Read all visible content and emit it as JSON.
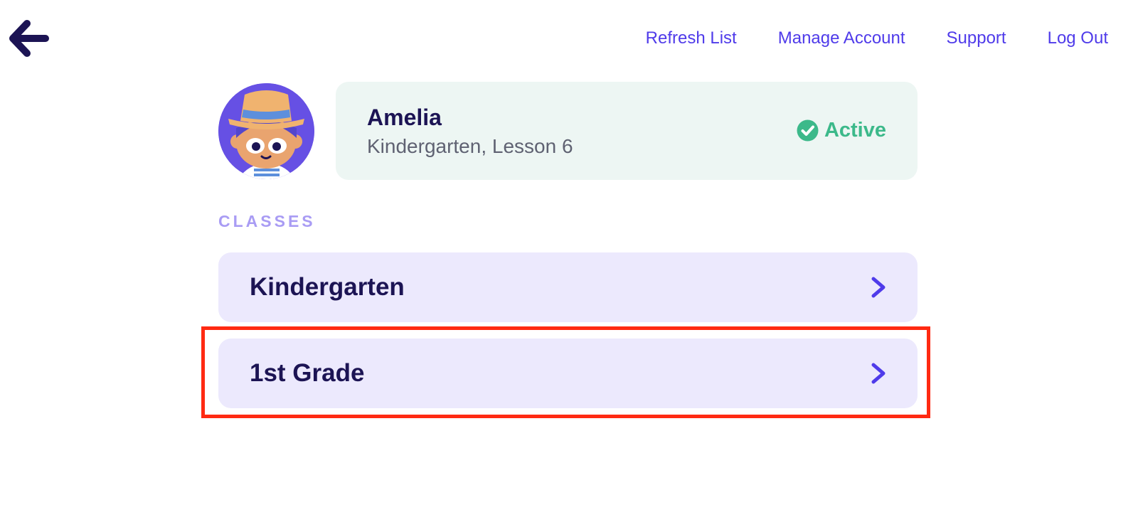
{
  "nav": {
    "back_icon": "arrow-left-icon",
    "links": [
      {
        "label": "Refresh List"
      },
      {
        "label": "Manage Account"
      },
      {
        "label": "Support"
      },
      {
        "label": "Log Out"
      }
    ]
  },
  "student": {
    "name": "Amelia",
    "lesson": "Kindergarten, Lesson 6",
    "status": "Active",
    "status_icon": "check-circle-icon",
    "avatar_icon": "child-avatar-icon"
  },
  "classes": {
    "section_label": "CLASSES",
    "items": [
      {
        "label": "Kindergarten",
        "icon": "chevron-right-icon"
      },
      {
        "label": "1st Grade",
        "icon": "chevron-right-icon"
      }
    ]
  },
  "colors": {
    "accent": "#4f3bea",
    "dark_text": "#1c1454",
    "active_green": "#3cb98a",
    "card_green_bg": "#edf6f3",
    "class_bg": "#ece9fd",
    "section_label": "#a99cf4",
    "highlight": "#ff2a12"
  }
}
